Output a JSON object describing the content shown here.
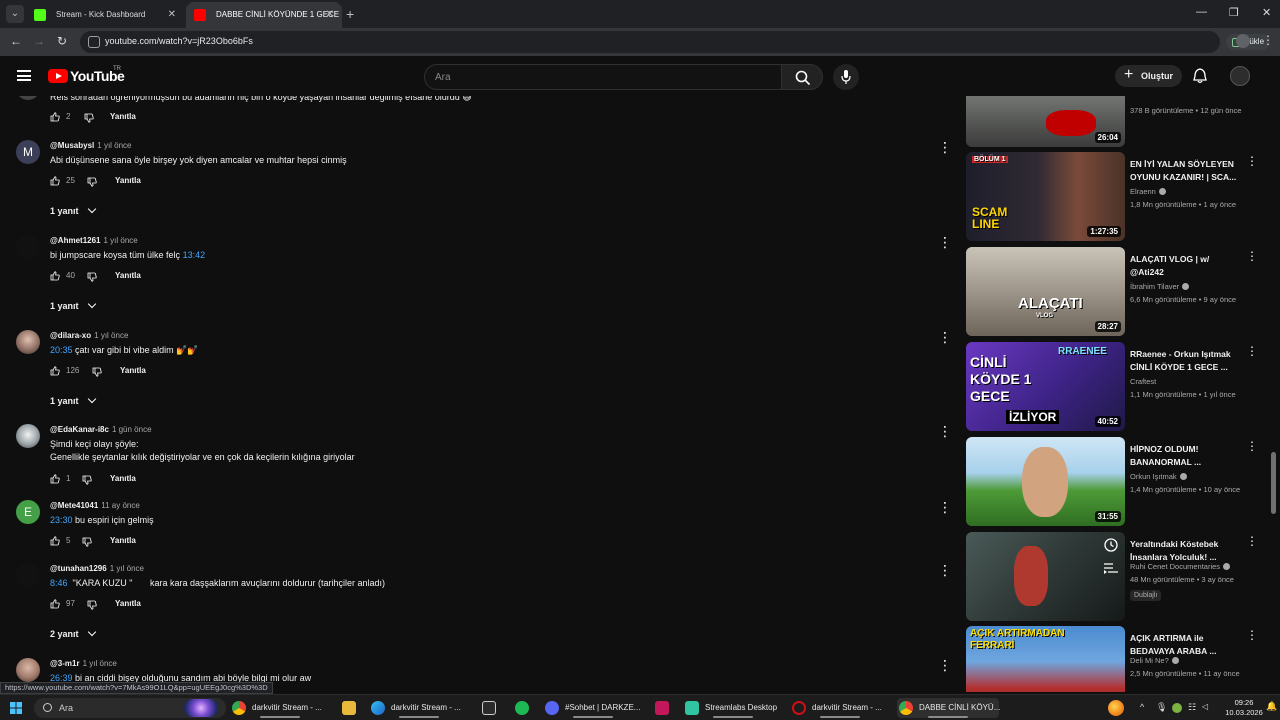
{
  "browser": {
    "tabs": [
      {
        "title": "Stream - Kick Dashboard",
        "favicon_color": "#53fc18",
        "active": false
      },
      {
        "title": "DABBE CİNLİ KÖYÜNDE 1 GECE",
        "favicon_color": "#ff0000",
        "active": true
      }
    ],
    "url": "youtube.com/watch?v=jR23Obo6bFs",
    "upload_label": "Yükle"
  },
  "youtube": {
    "logo_text": "YouTube",
    "country": "TR",
    "search_placeholder": "Ara",
    "create_label": "Oluştur"
  },
  "comments": [
    {
      "author": "",
      "age": "",
      "text": "Reis sonradan öğreniyormuşsun bu adamların hiç biri o köyde yaşayan insanlar değilmiş efsane olurdu 😅",
      "likes": "2",
      "reply_label": "Yanıtla",
      "avatar_letter": "",
      "avatar_color": "#444444",
      "partial": true
    },
    {
      "author": "@Musabysl",
      "age": "1 yıl önce",
      "text": "Abi düşünsene sana öyle birşey yok diyen amcalar ve muhtar hepsi cinmiş",
      "likes": "25",
      "reply_label": "Yanıtla",
      "avatar_letter": "M",
      "avatar_color": "#5c6bc0",
      "replies": "1 yanıt"
    },
    {
      "author": "@Ahmet1261",
      "age": "1 yıl önce",
      "timestamp": "13:42",
      "text": "bi jumpscare koysa tüm ülke felç",
      "likes": "40",
      "reply_label": "Yanıtla",
      "avatar_letter": "",
      "avatar_color": "#111111",
      "replies": "1 yanıt"
    },
    {
      "author": "@dilara-xo",
      "age": "1 yıl önce",
      "timestamp": "20:35",
      "text": "çatı var gibi bi vibe aldim 💅💅",
      "likes": "126",
      "reply_label": "Yanıtla",
      "avatar_letter": "",
      "avatar_color": "#c9a99a",
      "replies": "1 yanıt"
    },
    {
      "author": "@EdaKanar-i8c",
      "age": "1 gün önce",
      "text": "Şimdi keçi olayı şöyle:",
      "text2": "Genellikle şeytanlar kılık değiştiriyolar ve en çok da keçilerin kılığına giriyolar",
      "likes": "1",
      "reply_label": "Yanıtla",
      "avatar_letter": "",
      "avatar_color": "#9aa3a8"
    },
    {
      "author": "@Mete41041",
      "age": "11 ay önce",
      "timestamp": "23:30",
      "text": "bu espiri için gelmiş",
      "likes": "5",
      "reply_label": "Yanıtla",
      "avatar_letter": "E",
      "avatar_color": "#43a047"
    },
    {
      "author": "@tunahan1296",
      "age": "1 yıl önce",
      "timestamp": "8:46",
      "text": "\"KARA KUZU \"       kara kara daşşaklarım avuçlarını doldurur (tarihçiler anladı)",
      "likes": "97",
      "reply_label": "Yanıtla",
      "avatar_letter": "",
      "avatar_color": "#111111",
      "replies": "2 yanıt"
    },
    {
      "author": "@3-m1r",
      "age": "1 yıl önce",
      "timestamp": "26:39",
      "text": "bi an ciddi bişey olduğunu sandım abi böyle bilgi mi olur aw",
      "likes": "",
      "reply_label": "",
      "avatar_letter": "",
      "avatar_color": "#a07a6a"
    }
  ],
  "sidebar": [
    {
      "title": "",
      "channel": "",
      "views": "378 B görüntüleme",
      "age": "12 gün önce",
      "duration": "26:04",
      "thumb_text": "",
      "thumb_colors": [
        "#9fa8a3",
        "#5a5a5a"
      ],
      "verified": false
    },
    {
      "title": "EN İYİ YALAN SÖYLEYEN OYUNU KAZANIR! | SCA...",
      "channel": "Elraenn",
      "views": "1,8 Mn görüntüleme",
      "age": "1 ay önce",
      "duration": "1:27:35",
      "thumb_text": "SCAM LINE",
      "thumb_colors": [
        "#2b2b3a",
        "#7a3b2b"
      ],
      "verified": true
    },
    {
      "title": "ALAÇATI VLOG | w/ @Ati242",
      "channel": "İbrahim Tilaver",
      "views": "6,6 Mn görüntüleme",
      "age": "9 ay önce",
      "duration": "28:27",
      "thumb_text": "ALAÇATI",
      "thumb_colors": [
        "#b9b4a8",
        "#7d7468"
      ],
      "verified": true
    },
    {
      "title": "RRaenee - Orkun Işıtmak CİNLİ KÖYDE 1 GECE ...",
      "channel": "Craftest",
      "views": "1,1 Mn görüntüleme",
      "age": "1 yıl önce",
      "duration": "40:52",
      "thumb_text": "CİNLİ KÖYDE 1 GECE",
      "thumb_colors": [
        "#5a2ca8",
        "#2b1f5e"
      ],
      "verified": false
    },
    {
      "title": "HİPNOZ OLDUM! BANANORMAL ...",
      "channel": "Orkun Işıtmak",
      "views": "1,4 Mn görüntüleme",
      "age": "10 ay önce",
      "duration": "31:55",
      "thumb_text": "",
      "thumb_colors": [
        "#3a8a2e",
        "#cfe6f5"
      ],
      "verified": true
    },
    {
      "title": "Yeraltındaki Köstebek İnsanlara Yolculuk! ...",
      "channel": "Ruhi Cenet Documentaries",
      "views": "48 Mn görüntüleme",
      "age": "3 ay önce",
      "duration": "",
      "thumb_text": "",
      "thumb_colors": [
        "#3c4a48",
        "#1f2624"
      ],
      "verified": true,
      "badge": "Dublajlı"
    },
    {
      "title": "AÇIK ARTIRMA ile BEDAVAYA ARABA ...",
      "channel": "Deli Mi Ne?",
      "views": "2,5 Mn görüntüleme",
      "age": "11 ay önce",
      "duration": "",
      "thumb_text": "AÇIK ARTIRMADAN FERRARİ",
      "thumb_colors": [
        "#3d7fc4",
        "#c22a2a"
      ],
      "verified": true
    }
  ],
  "status_url": "https://www.youtube.com/watch?v=7MkAs99O1LQ&pp=ugUEEgJ0cg%3D%3D",
  "taskbar": {
    "search_label": "Ara",
    "items": [
      {
        "label": "darkvitir Stream - ...",
        "icon_color": "#4285f4"
      },
      {
        "label": "darkvitir Stream - ...",
        "icon_color": "#1e88e5"
      },
      {
        "label": "#Sohbet | DARKZE...",
        "icon_color": "#5865f2"
      },
      {
        "label": "Streamlabs Desktop",
        "icon_color": "#31c3a2"
      },
      {
        "label": "darkvitir Stream - ...",
        "icon_color": "#cc0f16"
      },
      {
        "label": "DABBE CİNLİ KÖYÜ...",
        "icon_color": "#4285f4"
      }
    ],
    "time": "09:26",
    "date": "10.03.2026"
  }
}
